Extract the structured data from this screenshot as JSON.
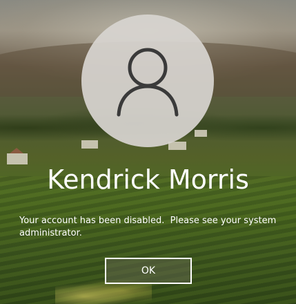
{
  "user": {
    "name": "Kendrick Morris",
    "avatar_icon": "user-silhouette-icon"
  },
  "message": {
    "text": "Your account has been disabled.  Please see your system administrator."
  },
  "actions": {
    "ok_label": "OK"
  },
  "colors": {
    "text": "#ffffff",
    "avatar_bg": "#d7d4d0",
    "avatar_icon": "#3a3a3a",
    "button_border": "#ffffff"
  }
}
